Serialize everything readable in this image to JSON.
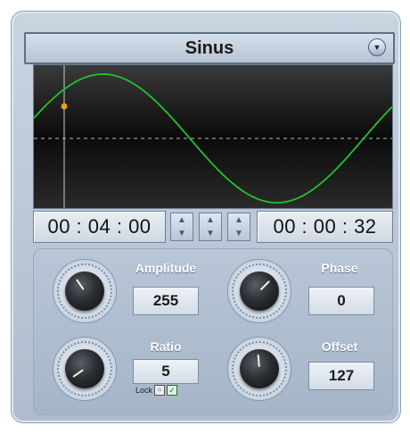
{
  "header": {
    "title": "Sinus",
    "dropdown_icon": "chevron-down-icon"
  },
  "display": {
    "wave_color": "#22c22a",
    "marker_color": "#e0a020",
    "background": "#000000"
  },
  "time": {
    "left": "00 : 04 : 00",
    "right": "00 : 00 : 32"
  },
  "controls": {
    "amplitude": {
      "label": "Amplitude",
      "value": "255"
    },
    "phase": {
      "label": "Phase",
      "value": "0"
    },
    "ratio": {
      "label": "Ratio",
      "value": "5",
      "lock_label": "Lock"
    },
    "offset": {
      "label": "Offset",
      "value": "127"
    }
  },
  "colors": {
    "panel": "#aebccd",
    "accent": "#3f5a86"
  }
}
